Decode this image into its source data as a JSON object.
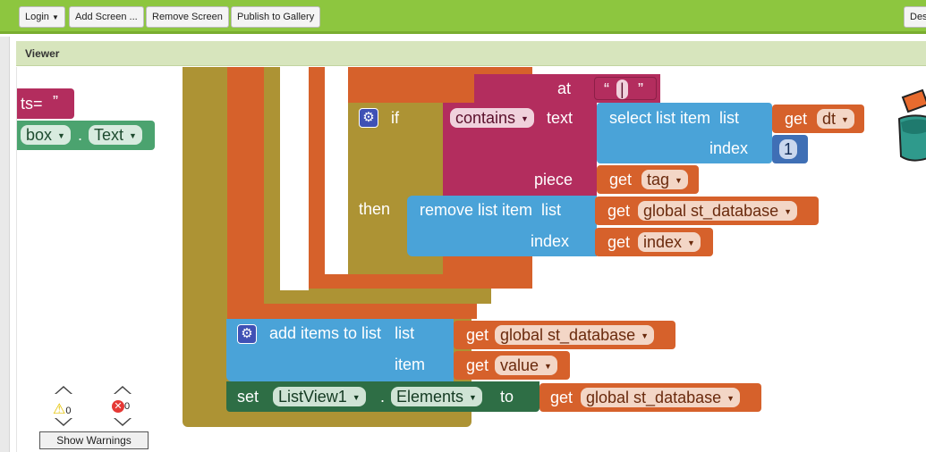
{
  "toolbar": {
    "login_label": "Login",
    "add_screen_label": "Add Screen ...",
    "remove_screen_label": "Remove Screen",
    "publish_label": "Publish to Gallery",
    "right_partial_label": "Des"
  },
  "viewer": {
    "title": "Viewer"
  },
  "colors": {
    "toolbar": "#8dc63f",
    "control_olive": "#ad9334",
    "variable_orange": "#d6612b",
    "text_magenta": "#b32d5e",
    "list_blue": "#4aa3d8",
    "component_green": "#2e6e45",
    "component_light_green": "#4ba36f",
    "math_blue": "#3f6fb5"
  },
  "blocks": {
    "partial_left_text": "ts=",
    "partial_left_quote": "”",
    "partial_component": "box",
    "partial_property": "Text",
    "at_label": "at",
    "at_string_open": "“",
    "at_string_value": "|",
    "at_string_close": "”",
    "if_label": "if",
    "contains_label": "contains",
    "text_label": "text",
    "select_list_item_label": "select list item",
    "list_label": "list",
    "get_label": "get",
    "dt_var": "dt",
    "index_label": "index",
    "index_value": "1",
    "piece_label": "piece",
    "tag_var": "tag",
    "then_label": "then",
    "remove_list_item_label": "remove list item",
    "global_st_database": "global st_database",
    "index_var": "index",
    "add_items_label": "add items to list",
    "item_label": "item",
    "value_var": "value",
    "set_label": "set",
    "component": "ListView1",
    "dot": ".",
    "property": "Elements",
    "to_label": "to"
  },
  "warnings": {
    "warning_count": "0",
    "error_count": "0",
    "show_warnings_label": "Show Warnings"
  }
}
